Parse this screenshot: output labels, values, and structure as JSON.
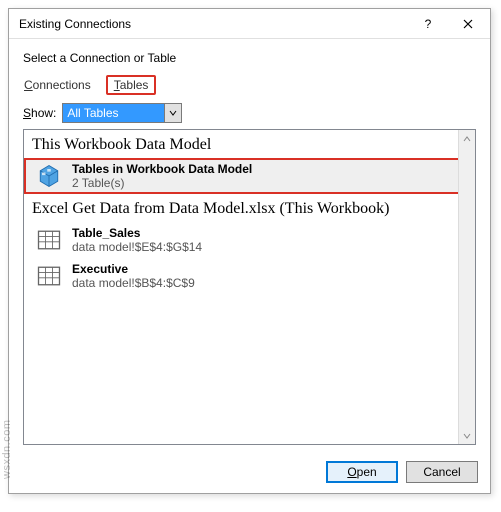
{
  "titlebar": {
    "title": "Existing Connections",
    "help_label": "?",
    "close_label": "×"
  },
  "subtitle": "Select a Connection or Table",
  "tabs": {
    "connections": "Connections",
    "tables": "Tables"
  },
  "show": {
    "label": "Show:",
    "selected": "All Tables"
  },
  "groups": {
    "wbdm": {
      "header": "This Workbook Data Model",
      "item": {
        "label": "Tables in Workbook Data Model",
        "sub": "2 Table(s)",
        "icon": "datamodel-cube-icon"
      }
    },
    "wb": {
      "header": "Excel Get Data from Data Model.xlsx (This Workbook)",
      "items": [
        {
          "label": "Table_Sales",
          "sub": "data model!$E$4:$G$14",
          "icon": "table-grid-icon"
        },
        {
          "label": "Executive",
          "sub": "data model!$B$4:$C$9",
          "icon": "table-grid-icon"
        }
      ]
    }
  },
  "buttons": {
    "open": "Open",
    "cancel": "Cancel"
  },
  "watermark": "wsxdn.com"
}
